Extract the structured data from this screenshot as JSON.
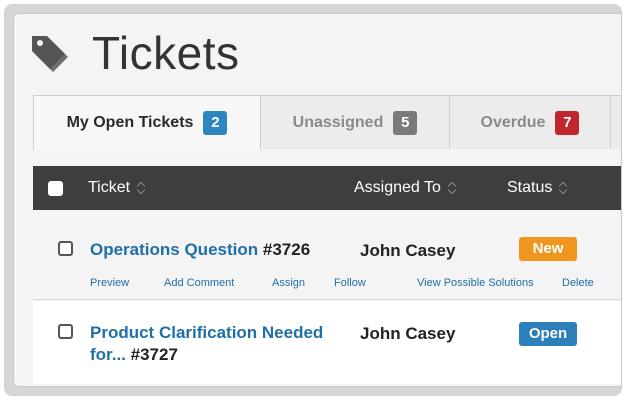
{
  "header": {
    "title": "Tickets",
    "icon": "tag-icon"
  },
  "tabs": [
    {
      "label": "My Open Tickets",
      "count": "2",
      "color": "#2e86c1",
      "active": true
    },
    {
      "label": "Unassigned",
      "count": "5",
      "color": "#7a7a7a",
      "active": false
    },
    {
      "label": "Overdue",
      "count": "7",
      "color": "#c0262d",
      "active": false
    }
  ],
  "table": {
    "columns": {
      "ticket": "Ticket",
      "assigned_to": "Assigned To",
      "status": "Status"
    },
    "rows": [
      {
        "title": "Operations Question",
        "number": "#3726",
        "assignee": "John Casey",
        "status": "New",
        "status_color": "#f0951e",
        "actions": [
          "Preview",
          "Add Comment",
          "Assign",
          "Follow",
          "View Possible Solutions",
          "Delete"
        ]
      },
      {
        "title": "Product Clarification Needed for...",
        "number": "#3727",
        "assignee": "John Casey",
        "status": "Open",
        "status_color": "#2c7fb8"
      }
    ]
  }
}
